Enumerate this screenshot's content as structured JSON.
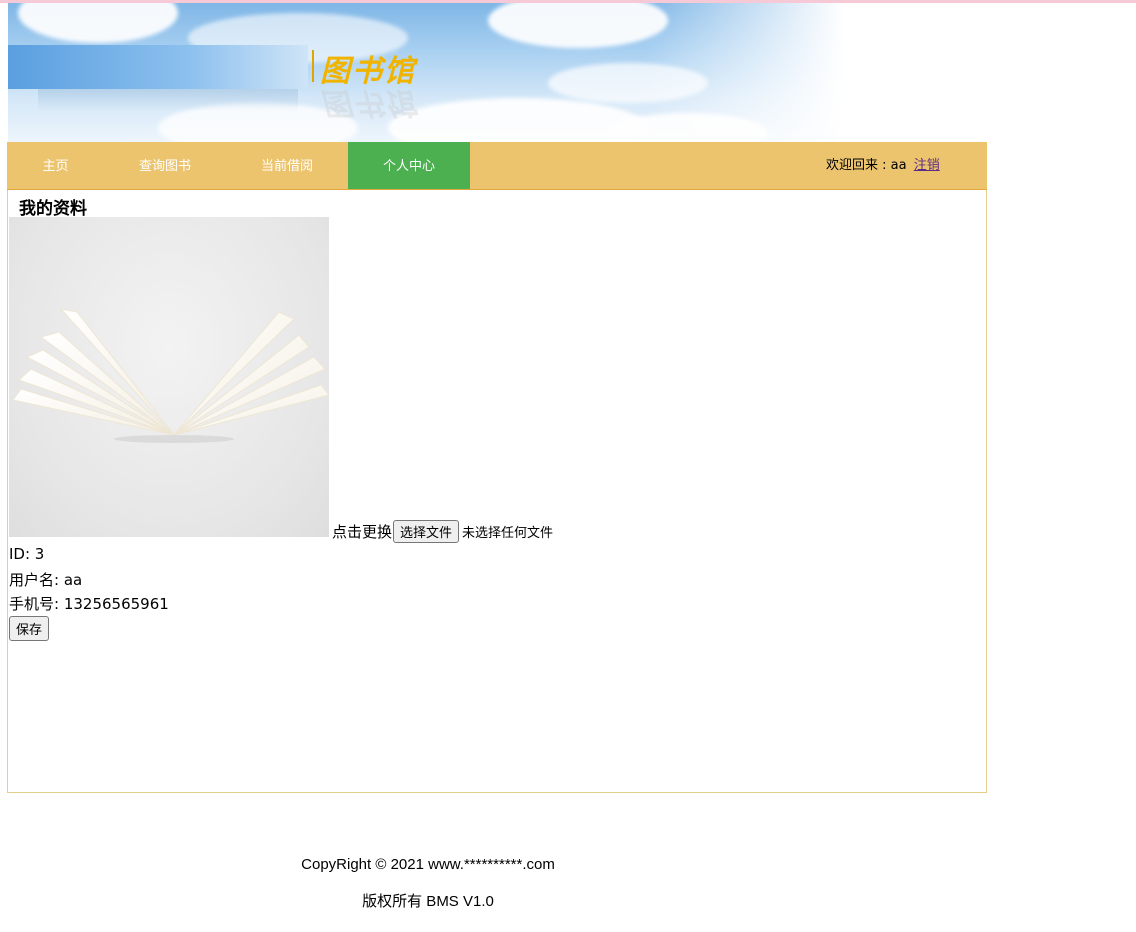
{
  "header": {
    "logo_text": "图书馆"
  },
  "nav": {
    "items": [
      {
        "label": "主页",
        "active": false
      },
      {
        "label": "查询图书",
        "active": false
      },
      {
        "label": "当前借阅",
        "active": false
      },
      {
        "label": "个人中心",
        "active": true
      }
    ],
    "welcome_text": "欢迎回来 : aa",
    "logout_label": "注销"
  },
  "profile": {
    "title": "我的资料",
    "change_label": "点击更换",
    "choose_file_label": "选择文件",
    "file_status": "未选择任何文件",
    "id_line": "ID: 3",
    "username_line": "用户名: aa",
    "phone_line": "手机号: 13256565961",
    "save_label": "保存"
  },
  "footer": {
    "copyright": "CopyRight © 2021 www.**********.com",
    "rights": "版权所有 BMS V1.0"
  },
  "colors": {
    "nav_bg": "#ecc46e",
    "nav_active": "#4caf50",
    "logo": "#f0b400"
  }
}
